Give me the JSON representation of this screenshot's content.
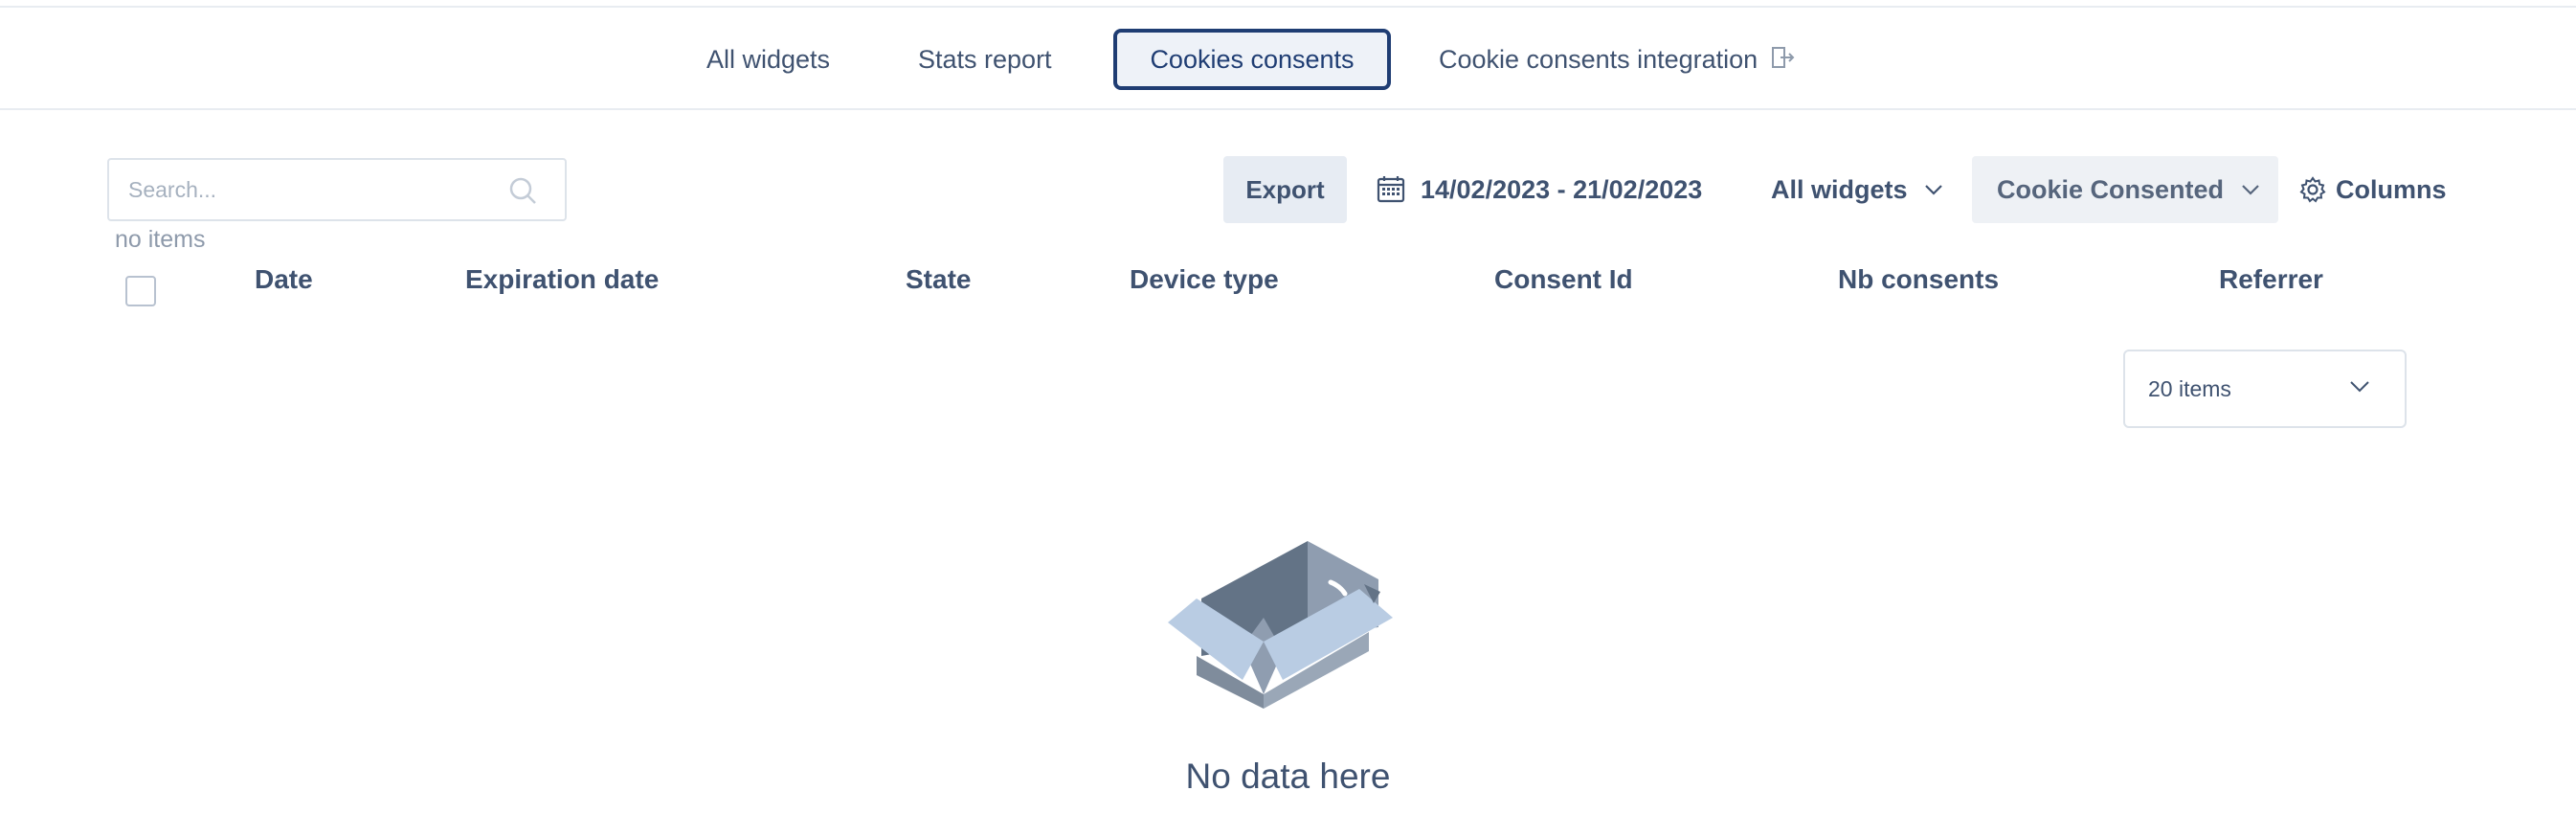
{
  "tabs": [
    {
      "label": "All widgets",
      "active": false
    },
    {
      "label": "Stats report",
      "active": false
    },
    {
      "label": "Cookies consents",
      "active": true
    },
    {
      "label": "Cookie consents integration",
      "active": false,
      "icon": "external-link-icon"
    }
  ],
  "toolbar": {
    "search_placeholder": "Search...",
    "export_label": "Export",
    "date_range": "14/02/2023 - 21/02/2023",
    "widgets_filter": "All widgets",
    "state_filter": "Cookie Consented",
    "columns_label": "Columns"
  },
  "table": {
    "count_text": "no items",
    "headers": [
      "Date",
      "Expiration date",
      "State",
      "Device type",
      "Consent Id",
      "Nb consents",
      "Referrer"
    ],
    "rows": []
  },
  "pagination": {
    "page_size": "20 items"
  },
  "empty_state": {
    "message": "No data here"
  },
  "colors": {
    "text": "#3f5270",
    "active_tab_border": "#1f3d73",
    "button_bg": "#e7ecf3",
    "border": "#dde3ea"
  }
}
